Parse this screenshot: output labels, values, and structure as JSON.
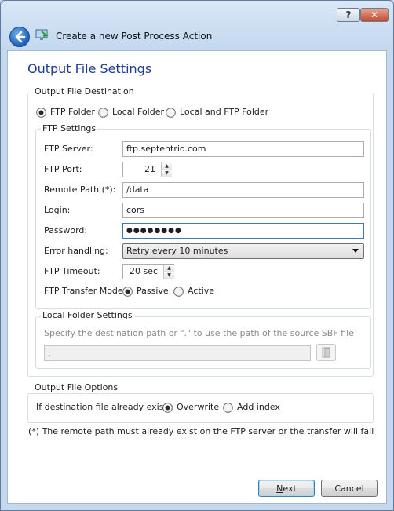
{
  "window": {
    "title": "Create a new Post Process Action",
    "help_label": "?",
    "close_label": "✕"
  },
  "page": {
    "heading": "Output File Settings"
  },
  "destination": {
    "legend": "Output File Destination",
    "options": [
      {
        "label": "FTP Folder",
        "selected": true
      },
      {
        "label": "Local Folder",
        "selected": false
      },
      {
        "label": "Local and FTP Folder",
        "selected": false
      }
    ]
  },
  "ftp": {
    "legend": "FTP Settings",
    "server_label": "FTP Server:",
    "server_value": "ftp.septentrio.com",
    "port_label": "FTP Port:",
    "port_value": "21",
    "remote_path_label": "Remote Path (*):",
    "remote_path_value": "/data",
    "login_label": "Login:",
    "login_value": "cors",
    "password_label": "Password:",
    "password_value": "●●●●●●●●",
    "error_label": "Error handling:",
    "error_value": "Retry every 10 minutes",
    "timeout_label": "FTP Timeout:",
    "timeout_value": "20 sec",
    "transfer_mode_label": "FTP Transfer Mode:",
    "transfer_modes": [
      {
        "label": "Passive",
        "selected": true
      },
      {
        "label": "Active",
        "selected": false
      }
    ]
  },
  "local": {
    "legend": "Local Folder Settings",
    "hint": "Specify the destination path or \".\" to use the path of the source SBF file",
    "path_value": "."
  },
  "options": {
    "legend": "Output File Options",
    "exists_label": "If destination file already exists:",
    "choices": [
      {
        "label": "Overwrite",
        "selected": true
      },
      {
        "label": "Add index",
        "selected": false
      }
    ]
  },
  "footnote": "(*) The remote path must already exist on the FTP server or the transfer will fail",
  "buttons": {
    "next_mnemonic": "N",
    "next_rest": "ext",
    "cancel_label": "Cancel"
  },
  "colors": {
    "heading": "#1f3d94",
    "radio_dot": "#2b2b2b",
    "close_button": "#c34a2d"
  },
  "icons": {
    "back": "back-arrow-icon",
    "wizard": "monitor-arrow-icon",
    "browse": "folder-browse-icon"
  }
}
